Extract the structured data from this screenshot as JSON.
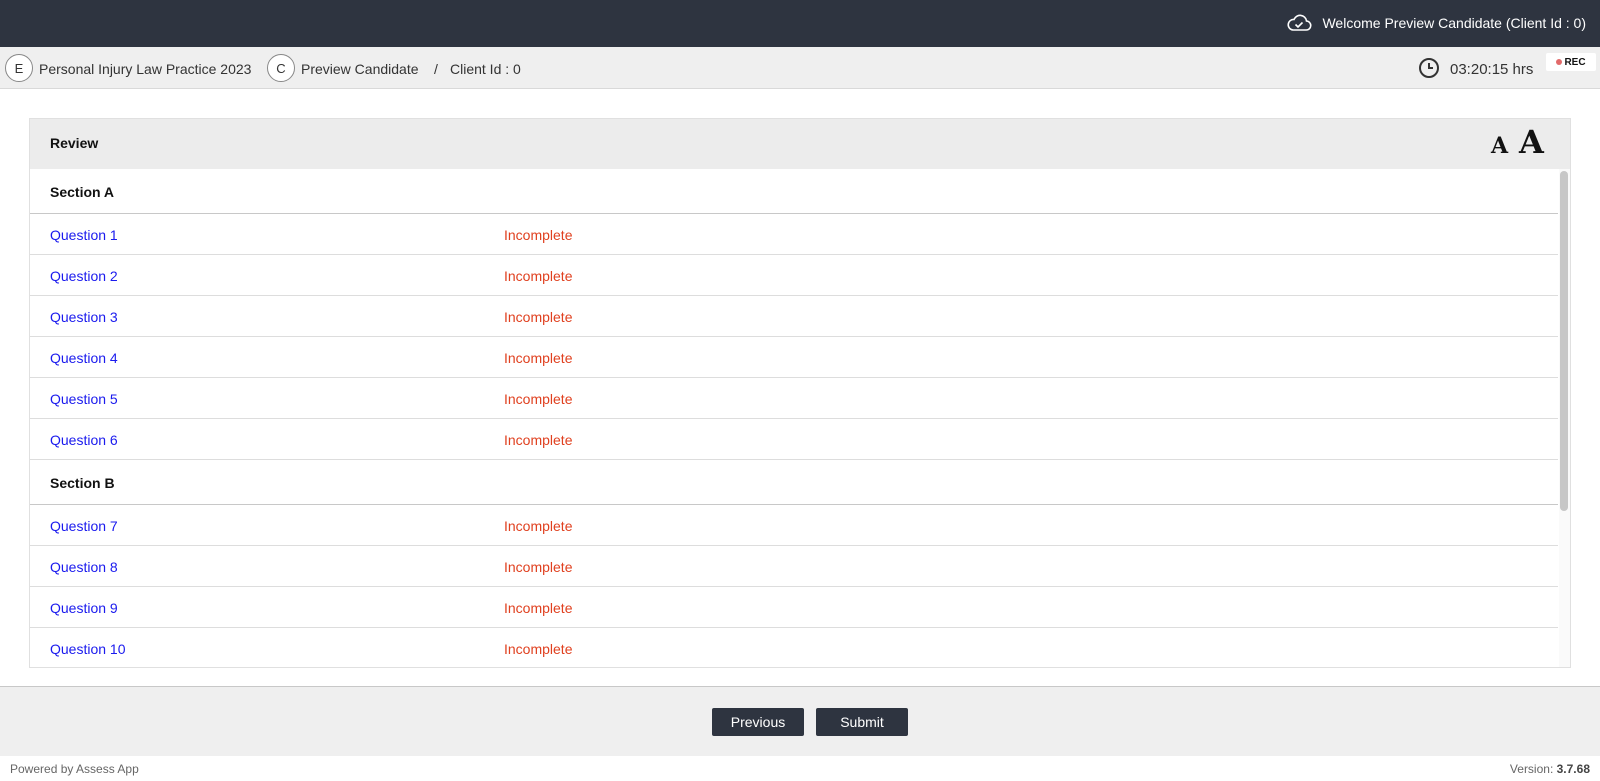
{
  "header": {
    "welcome": "Welcome Preview Candidate (Client Id : 0)",
    "cloud_icon": "cloud-check-icon"
  },
  "subheader": {
    "exam_badge": "E",
    "exam_name": "Personal Injury Law Practice 2023",
    "candidate_badge": "C",
    "candidate_name": "Preview Candidate",
    "separator": "/",
    "client_id": "Client Id : 0",
    "timer": "03:20:15 hrs",
    "rec_label": "REC"
  },
  "review": {
    "title": "Review",
    "font_small_label": "A",
    "font_large_label": "A",
    "sections": [
      {
        "label": "Section A",
        "questions": [
          {
            "label": "Question 1",
            "status": "Incomplete"
          },
          {
            "label": "Question 2",
            "status": "Incomplete"
          },
          {
            "label": "Question 3",
            "status": "Incomplete"
          },
          {
            "label": "Question 4",
            "status": "Incomplete"
          },
          {
            "label": "Question 5",
            "status": "Incomplete"
          },
          {
            "label": "Question 6",
            "status": "Incomplete"
          }
        ]
      },
      {
        "label": "Section B",
        "questions": [
          {
            "label": "Question 7",
            "status": "Incomplete"
          },
          {
            "label": "Question 8",
            "status": "Incomplete"
          },
          {
            "label": "Question 9",
            "status": "Incomplete"
          },
          {
            "label": "Question 10",
            "status": "Incomplete"
          }
        ]
      }
    ]
  },
  "nav": {
    "previous_label": "Previous",
    "submit_label": "Submit"
  },
  "footer": {
    "powered_by": "Powered by Assess App",
    "version_label": "Version:",
    "version_number": "3.7.68"
  },
  "colors": {
    "topbar": "#2e3440",
    "link": "#1a1aee",
    "incomplete": "#e0401f"
  }
}
